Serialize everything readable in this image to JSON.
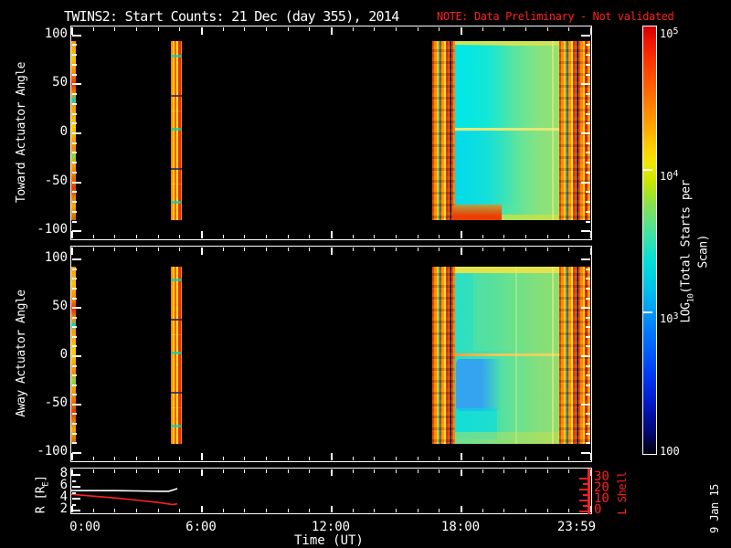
{
  "title": {
    "text": "TWINS2: Start Counts: 21 Dec (day 355), 2014"
  },
  "note": {
    "text": "NOTE: Data Preliminary - Not validated",
    "color": "#ff2121"
  },
  "footer_timestamp": "9 Jan 15",
  "x_axis": {
    "label": "Time (UT)",
    "major_ticks": [
      {
        "hour": 0,
        "label": "0:00"
      },
      {
        "hour": 6,
        "label": "6:00"
      },
      {
        "hour": 12,
        "label": "12:00"
      },
      {
        "hour": 18,
        "label": "18:00"
      },
      {
        "hour": 24,
        "label": "23:59"
      }
    ],
    "minor_tick_every_hours": 1
  },
  "colorbar": {
    "label_pre": "LOG",
    "label_sub": "10",
    "label_post": "(Total Starts per Scan)",
    "tick_labels": [
      {
        "base": "10",
        "exp": "5",
        "value": 100000
      },
      {
        "base": "10",
        "exp": "4",
        "value": 10000
      },
      {
        "base": "10",
        "exp": "3",
        "value": 1000
      },
      {
        "base": "100",
        "exp": "",
        "value": 100
      }
    ],
    "scale": "log10",
    "colors_top_to_bottom": [
      "#cc0000",
      "#ff6600",
      "#ffcc00",
      "#99e333",
      "#00dfd8",
      "#007bff",
      "#0010a0",
      "#000010"
    ]
  },
  "chart_data": [
    {
      "type": "heatmap",
      "panel": "toward",
      "y_label": "Toward Actuator Angle",
      "y_ticks": [
        100,
        50,
        0,
        -50,
        -100
      ],
      "y_minor_step": 10,
      "y_range": [
        -100,
        100
      ],
      "x_range_hours": [
        0,
        24
      ],
      "z_label": "LOG10(Total Starts per Scan)",
      "z_range_log10": [
        2,
        5
      ],
      "data_intervals_hours": [
        [
          0.0,
          0.2
        ],
        [
          4.6,
          5.1
        ],
        [
          16.7,
          24.0
        ]
      ],
      "summary": "Sparse orange scans near 00:00 and ~04:45; continuous block 16:40-24:00 with cyan-green interior (~10^3.5), orange/red noisy scan edges (~10^4.5), pale yellow line at 0 deg, red-orange blob near -90 deg at block start"
    },
    {
      "type": "heatmap",
      "panel": "away",
      "y_label": "Away Actuator Angle",
      "y_ticks": [
        100,
        50,
        0,
        -50,
        -100
      ],
      "y_minor_step": 10,
      "y_range": [
        -100,
        100
      ],
      "x_range_hours": [
        0,
        24
      ],
      "z_label": "LOG10(Total Starts per Scan)",
      "z_range_log10": [
        2,
        5
      ],
      "data_intervals_hours": [
        [
          0.0,
          0.2
        ],
        [
          4.6,
          5.1
        ],
        [
          16.7,
          24.0
        ]
      ],
      "summary": "Same coverage as toward panel; yellow top row at +90 deg, blue patch (~10^3) below 0 deg early in the block, yellow-orange line at 0 deg"
    },
    {
      "type": "line",
      "panel": "ephemeris",
      "y_left_label_pre": "R [R",
      "y_left_label_sub": "E",
      "y_left_label_post": "]",
      "y_left_ticks": [
        8,
        6,
        4,
        2
      ],
      "y_left_minor_ticks": [
        7,
        5,
        3
      ],
      "y_right_label": "L Shell",
      "y_right_ticks": [
        30,
        20,
        10,
        0
      ],
      "y_right_minor_ticks": [
        25,
        15,
        5
      ],
      "series": [
        {
          "name": "R",
          "color": "#ffffff",
          "axis": "left",
          "points_hours_value": [
            [
              0,
              5.2
            ],
            [
              1,
              5.2
            ],
            [
              2,
              5.2
            ],
            [
              3,
              5.15
            ],
            [
              4,
              5.1
            ],
            [
              4.5,
              5.1
            ],
            [
              4.75,
              5.35
            ],
            [
              4.9,
              5.55
            ]
          ]
        },
        {
          "name": "L Shell",
          "color": "#ff2121",
          "axis": "right",
          "points_hours_value": [
            [
              0,
              14.8
            ],
            [
              1,
              13.2
            ],
            [
              2,
              11.5
            ],
            [
              3,
              9.6
            ],
            [
              4,
              7.4
            ],
            [
              4.5,
              6.0
            ],
            [
              4.7,
              5.5
            ],
            [
              4.9,
              6.1
            ]
          ]
        }
      ]
    }
  ]
}
